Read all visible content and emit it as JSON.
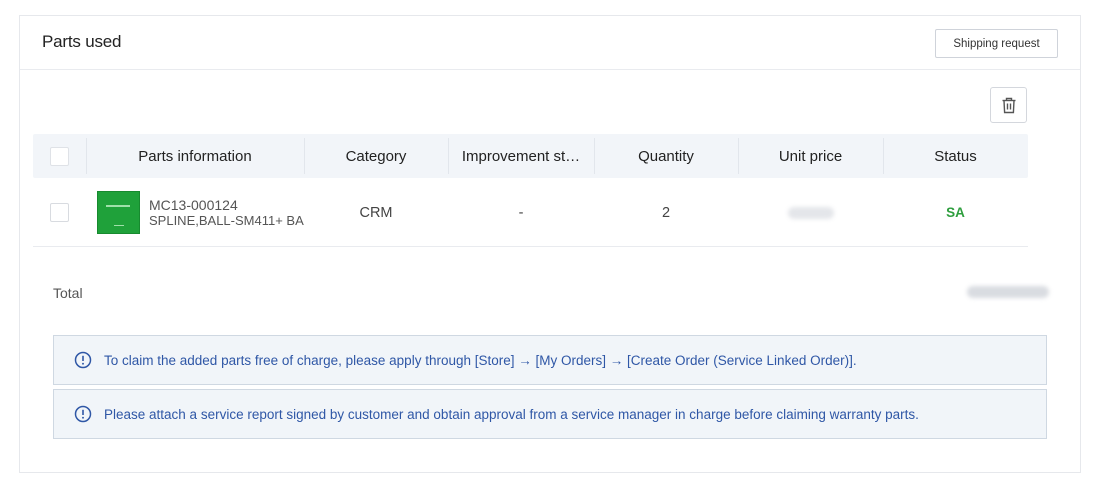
{
  "panel": {
    "title": "Parts used",
    "shipping_button": "Shipping request"
  },
  "toolbar": {
    "delete_icon": "trash-icon"
  },
  "table": {
    "columns": [
      "Parts information",
      "Category",
      "Improvement st…",
      "Quantity",
      "Unit price",
      "Status"
    ],
    "rows": [
      {
        "part_code": "MC13-000124",
        "part_name": "SPLINE,BALL-SM411+ BA",
        "category": "CRM",
        "improvement": "-",
        "quantity": "2",
        "unit_price": "",
        "status": "SA"
      }
    ]
  },
  "total": {
    "label": "Total",
    "value": ""
  },
  "notices": [
    {
      "icon": "info-circle-icon",
      "text": "To claim the added parts free of charge, please apply through [Store] → [My Orders] → [Create Order (Service Linked Order)]."
    },
    {
      "icon": "info-circle-icon",
      "text": "Please attach a service report signed by customer and obtain approval from a service manager in charge before claiming warranty parts."
    }
  ],
  "colors": {
    "status_sa": "#2e9e3e",
    "notice_text": "#2f57a6",
    "notice_bg": "#f1f5f9",
    "header_bg": "#f2f5f9"
  }
}
